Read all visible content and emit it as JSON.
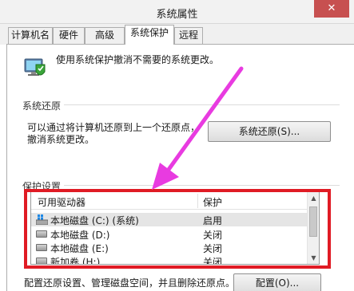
{
  "window": {
    "title": "系统属性",
    "close_glyph": "✕"
  },
  "tabs": [
    {
      "label": "计算机名"
    },
    {
      "label": "硬件"
    },
    {
      "label": "高级"
    },
    {
      "label": "系统保护"
    },
    {
      "label": "远程"
    }
  ],
  "active_tab": "系统保护",
  "intro": "使用系统保护撤消不需要的系统更改。",
  "restore": {
    "group_label": "系统还原",
    "description": "可以通过将计算机还原到上一个还原点，撤消系统更改。",
    "button_label": "系统还原(S)..."
  },
  "protection": {
    "group_label": "保护设置",
    "columns": [
      "可用驱动器",
      "保护"
    ],
    "drives": [
      {
        "name": "本地磁盘 (C:) (系统)",
        "protection": "启用",
        "icon": "system-drive-icon"
      },
      {
        "name": "本地磁盘 (D:)",
        "protection": "关闭",
        "icon": "drive-icon"
      },
      {
        "name": "本地磁盘 (E:)",
        "protection": "关闭",
        "icon": "drive-icon"
      },
      {
        "name": "新加卷 (H:)",
        "protection": "关闭",
        "icon": "drive-icon"
      }
    ],
    "configure_text": "配置还原设置、管理磁盘空间，并且删除还原点。",
    "configure_button": "配置(O)..."
  },
  "annotation": {
    "highlight_color": "#e01b24",
    "arrow_color": "#e83be0"
  }
}
